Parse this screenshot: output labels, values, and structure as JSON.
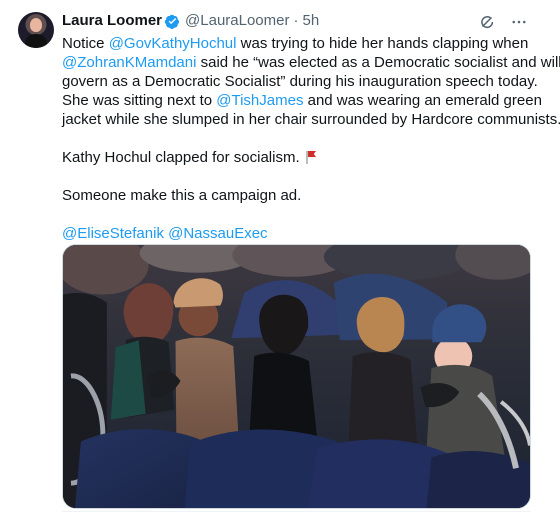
{
  "tweet": {
    "author": {
      "display_name": "Laura Loomer",
      "handle": "@LauraLoomer",
      "separator": "·",
      "time": "5h"
    },
    "body_lines": [
      [
        {
          "text": "Notice ",
          "type": "text"
        },
        {
          "text": "@GovKathyHochul",
          "type": "mention"
        },
        {
          "text": " was trying to hide her hands clapping when",
          "type": "text"
        }
      ],
      [
        {
          "text": "@ZohranKMamdani",
          "type": "mention"
        },
        {
          "text": " said he “was elected as a Democratic socialist and will",
          "type": "text"
        }
      ],
      [
        {
          "text": "govern as a Democratic Socialist” during his inauguration speech today.",
          "type": "text"
        }
      ],
      [
        {
          "text": "She was sitting next to ",
          "type": "text"
        },
        {
          "text": "@TishJames",
          "type": "mention"
        },
        {
          "text": " and was wearing an emerald green",
          "type": "text"
        }
      ],
      [
        {
          "text": "jacket while she slumped in her chair surrounded by Hardcore communists.",
          "type": "text"
        }
      ]
    ],
    "line_2": "Kathy Hochul clapped for socialism.",
    "line_3": "Someone make this a campaign ad.",
    "mentions_footer": "@EliseStefanik @NassauExec",
    "icons": {
      "verified": "verified-badge-icon",
      "grok": "grok-icon",
      "more": "more-options-icon",
      "flag": "red-flag-icon"
    },
    "colors": {
      "link": "#1d9bf0",
      "muted": "#536471",
      "verified": "#1d9bf0",
      "flag": "#d12d2d"
    }
  }
}
